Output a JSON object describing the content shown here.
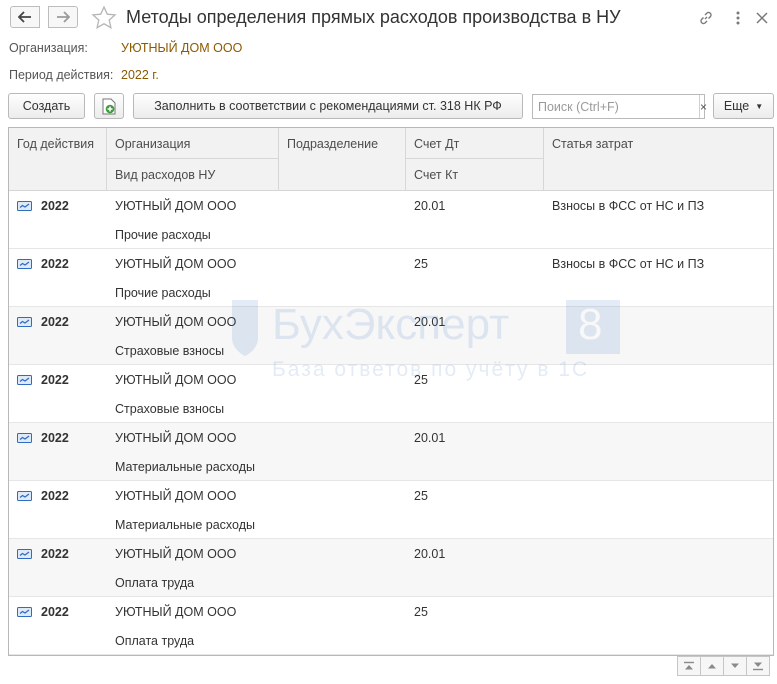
{
  "window": {
    "title": "Методы определения прямых расходов производства в НУ"
  },
  "fields": {
    "organization_label": "Организация:",
    "organization_value": "УЮТНЫЙ ДОМ ООО",
    "period_label": "Период действия:",
    "period_value": "2022 г."
  },
  "toolbar": {
    "create_label": "Создать",
    "fill_label": "Заполнить в соответствии с рекомендациями ст. 318 НК РФ",
    "search_placeholder": "Поиск (Ctrl+F)",
    "search_clear": "×",
    "more_label": "Еще"
  },
  "table": {
    "headers": {
      "year": "Год действия",
      "organization": "Организация",
      "expense_type": "Вид расходов НУ",
      "department": "Подразделение",
      "debit": "Счет Дт",
      "credit": "Счет Кт",
      "cost_item": "Статья затрат"
    },
    "rows": [
      {
        "year": "2022",
        "organization": "УЮТНЫЙ ДОМ ООО",
        "expense_type": "Прочие расходы",
        "debit": "20.01",
        "cost_item": "Взносы в ФСС от НС и ПЗ"
      },
      {
        "year": "2022",
        "organization": "УЮТНЫЙ ДОМ ООО",
        "expense_type": "Прочие расходы",
        "debit": "25",
        "cost_item": "Взносы в ФСС от НС и ПЗ"
      },
      {
        "year": "2022",
        "organization": "УЮТНЫЙ ДОМ ООО",
        "expense_type": "Страховые взносы",
        "debit": "20.01",
        "cost_item": ""
      },
      {
        "year": "2022",
        "organization": "УЮТНЫЙ ДОМ ООО",
        "expense_type": "Страховые взносы",
        "debit": "25",
        "cost_item": ""
      },
      {
        "year": "2022",
        "organization": "УЮТНЫЙ ДОМ ООО",
        "expense_type": "Материальные расходы",
        "debit": "20.01",
        "cost_item": ""
      },
      {
        "year": "2022",
        "organization": "УЮТНЫЙ ДОМ ООО",
        "expense_type": "Материальные расходы",
        "debit": "25",
        "cost_item": ""
      },
      {
        "year": "2022",
        "organization": "УЮТНЫЙ ДОМ ООО",
        "expense_type": "Оплата труда",
        "debit": "20.01",
        "cost_item": ""
      },
      {
        "year": "2022",
        "organization": "УЮТНЫЙ ДОМ ООО",
        "expense_type": "Оплата труда",
        "debit": "25",
        "cost_item": ""
      }
    ]
  },
  "watermark": {
    "brand": "БухЭксперт",
    "digit": "8",
    "tagline": "База ответов по учёту в 1С"
  },
  "icons": {
    "back": "arrow-left-icon",
    "forward": "arrow-right-icon",
    "favorite": "star-icon",
    "link": "link-icon",
    "menu": "more-vertical-icon",
    "close": "close-icon",
    "add_copy": "add-document-icon",
    "row": "record-icon"
  },
  "colors": {
    "accent_value": "#8b5a00",
    "row_icon": "#2f6bc2",
    "add_icon": "#3b9a3b"
  }
}
